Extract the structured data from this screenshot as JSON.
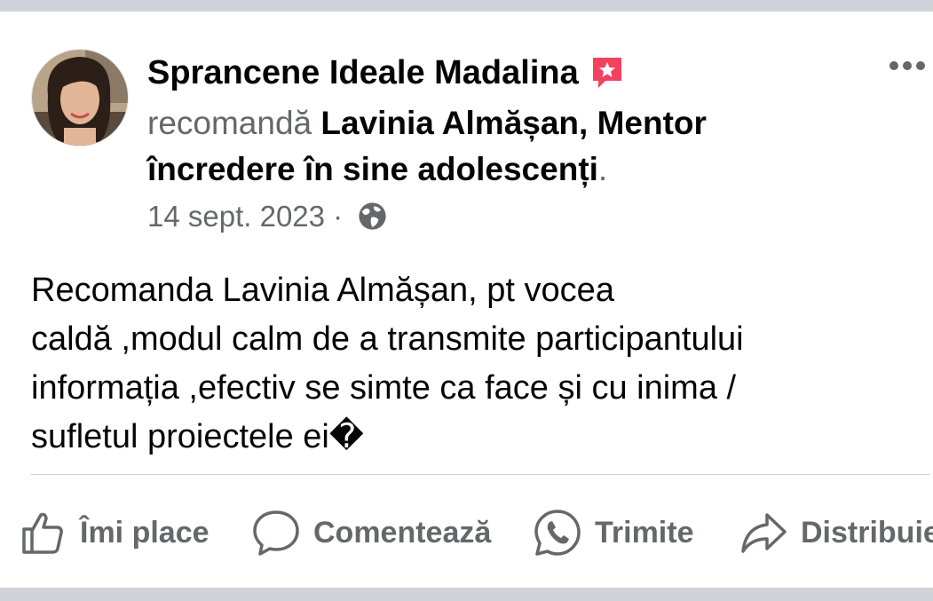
{
  "post": {
    "author": "Sprancene Ideale Madalina",
    "recommends_prefix": "recomandă ",
    "recommended_page": "Lavinia Almășan, Mentor încredere în sine adolescenți",
    "recommends_suffix": ".",
    "date": "14 sept. 2023",
    "date_separator": " · ",
    "privacy_icon": "globe-icon",
    "body": "Recomanda Lavinia Almășan, pt vocea\ncaldă ,modul calm de a transmite participantului\ninformația ,efectiv se simte ca face și cu inima /\nsufletul  proiectele ei�"
  },
  "actions": {
    "like": "Îmi place",
    "comment": "Comentează",
    "send": "Trimite",
    "share": "Distribuie"
  },
  "colors": {
    "text_primary": "#050505",
    "text_secondary": "#65676b",
    "badge": "#f3425f",
    "background_bar": "#cfd3d9"
  }
}
